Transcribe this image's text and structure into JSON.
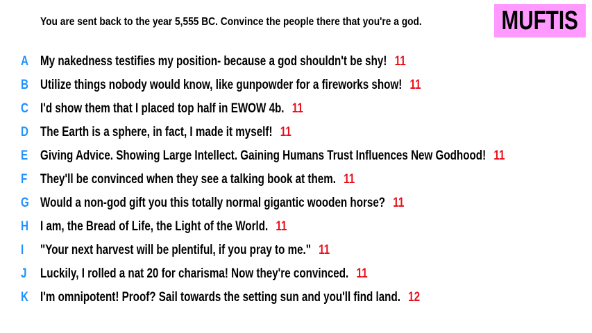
{
  "prompt": "You are sent back to the year 5,555 BC. Convince the people there that you're a god.",
  "badge": {
    "label": "MUFTIS",
    "color": "#ff99ff"
  },
  "colors": {
    "letter": "#1e90ff",
    "score": "#e8101a",
    "text": "#000000"
  },
  "entries": [
    {
      "letter": "A",
      "text": "My nakedness testifies my position- because a god shouldn't be shy!",
      "score": "11"
    },
    {
      "letter": "B",
      "text": "Utilize things nobody would know, like gunpowder for a fireworks show!",
      "score": "11"
    },
    {
      "letter": "C",
      "text": "I'd show them that I placed top half in EWOW 4b.",
      "score": "11"
    },
    {
      "letter": "D",
      "text": "The Earth is a sphere, in fact, I made it myself!",
      "score": "11"
    },
    {
      "letter": "E",
      "text": "Giving Advice. Showing Large Intellect. Gaining Humans Trust Influences New Godhood!",
      "score": "11"
    },
    {
      "letter": "F",
      "text": "They'll be convinced when they see a talking book at them.",
      "score": "11"
    },
    {
      "letter": "G",
      "text": "Would a non-god gift you this totally normal gigantic wooden horse?",
      "score": "11"
    },
    {
      "letter": "H",
      "text": "I am, the Bread of Life, the Light of the World.",
      "score": "11"
    },
    {
      "letter": "I",
      "text": "\"Your next harvest will be plentiful, if you pray to me.\"",
      "score": "11"
    },
    {
      "letter": "J",
      "text": "Luckily, I rolled a nat 20 for charisma! Now they're convinced.",
      "score": "11"
    },
    {
      "letter": "K",
      "text": "I'm omnipotent! Proof? Sail towards the setting sun and you'll find land.",
      "score": "12"
    }
  ]
}
